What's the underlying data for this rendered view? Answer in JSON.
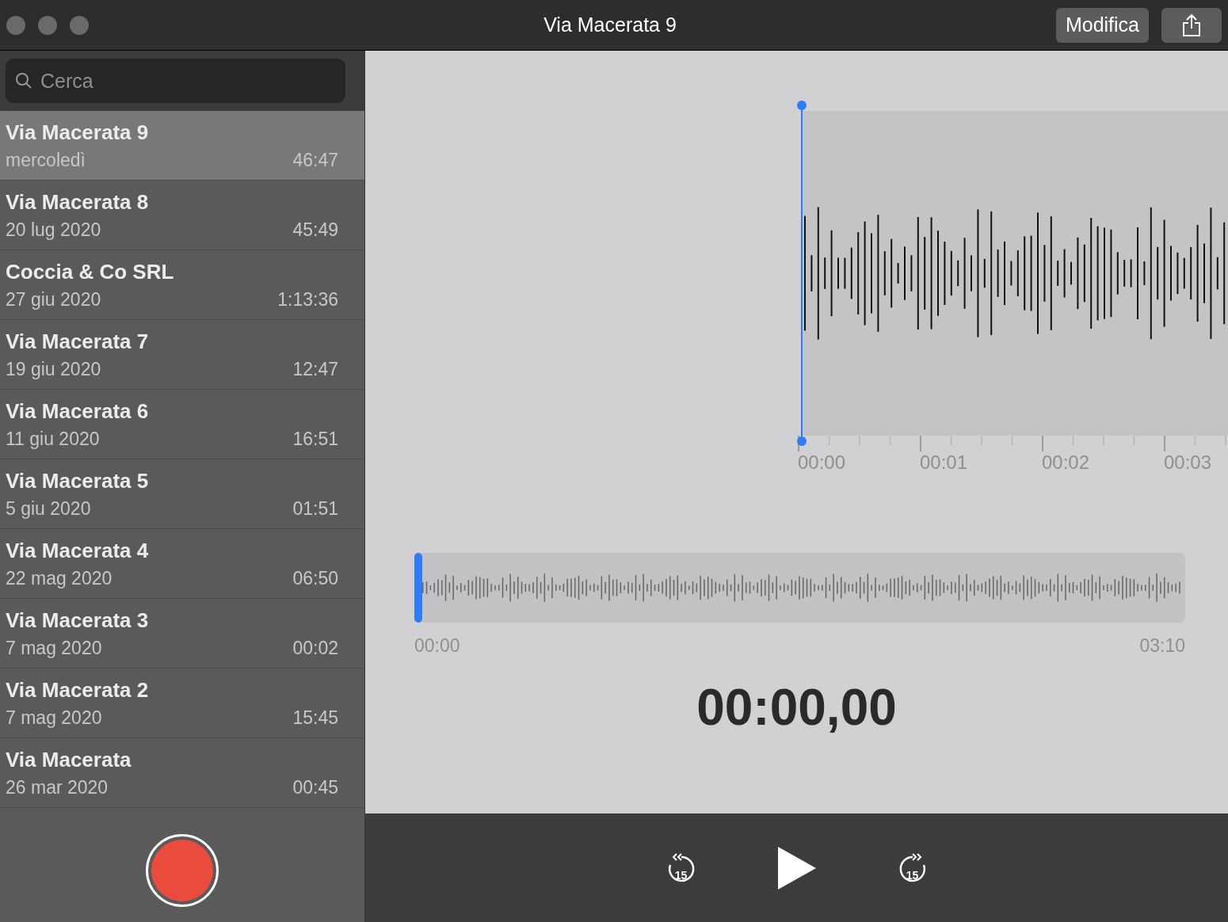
{
  "window": {
    "title": "Via Macerata 9",
    "buttons": [
      {
        "kind": "text",
        "label": "Modifica"
      },
      {
        "kind": "share"
      }
    ]
  },
  "search": {
    "placeholder": "Cerca"
  },
  "recordings": [
    {
      "title": "Via Macerata 9",
      "date": "mercoledì",
      "duration": "46:47",
      "selected": true
    },
    {
      "title": "Via Macerata 8",
      "date": "20 lug 2020",
      "duration": "45:49",
      "selected": false
    },
    {
      "title": "Coccia & Co SRL",
      "date": "27 giu 2020",
      "duration": "1:13:36",
      "selected": false
    },
    {
      "title": "Via Macerata 7",
      "date": "19 giu 2020",
      "duration": "12:47",
      "selected": false
    },
    {
      "title": "Via Macerata 6",
      "date": "11 giu 2020",
      "duration": "16:51",
      "selected": false
    },
    {
      "title": "Via Macerata 5",
      "date": "5 giu 2020",
      "duration": "01:51",
      "selected": false
    },
    {
      "title": "Via Macerata 4",
      "date": "22 mag 2020",
      "duration": "06:50",
      "selected": false
    },
    {
      "title": "Via Macerata 3",
      "date": "7 mag 2020",
      "duration": "00:02",
      "selected": false
    },
    {
      "title": "Via Macerata 2",
      "date": "7 mag 2020",
      "duration": "15:45",
      "selected": false
    },
    {
      "title": "Via Macerata",
      "date": "26 mar 2020",
      "duration": "00:45",
      "selected": false
    }
  ],
  "timeline": {
    "ticks": [
      "00:00",
      "00:01",
      "00:02",
      "00:03"
    ]
  },
  "overview": {
    "start": "00:00",
    "end": "03:10",
    "level": 0
  },
  "current_time": "00:00,00",
  "controls": [
    {
      "kind": "back",
      "label": "15"
    },
    {
      "kind": "play"
    },
    {
      "kind": "forward",
      "label": "15"
    }
  ]
}
